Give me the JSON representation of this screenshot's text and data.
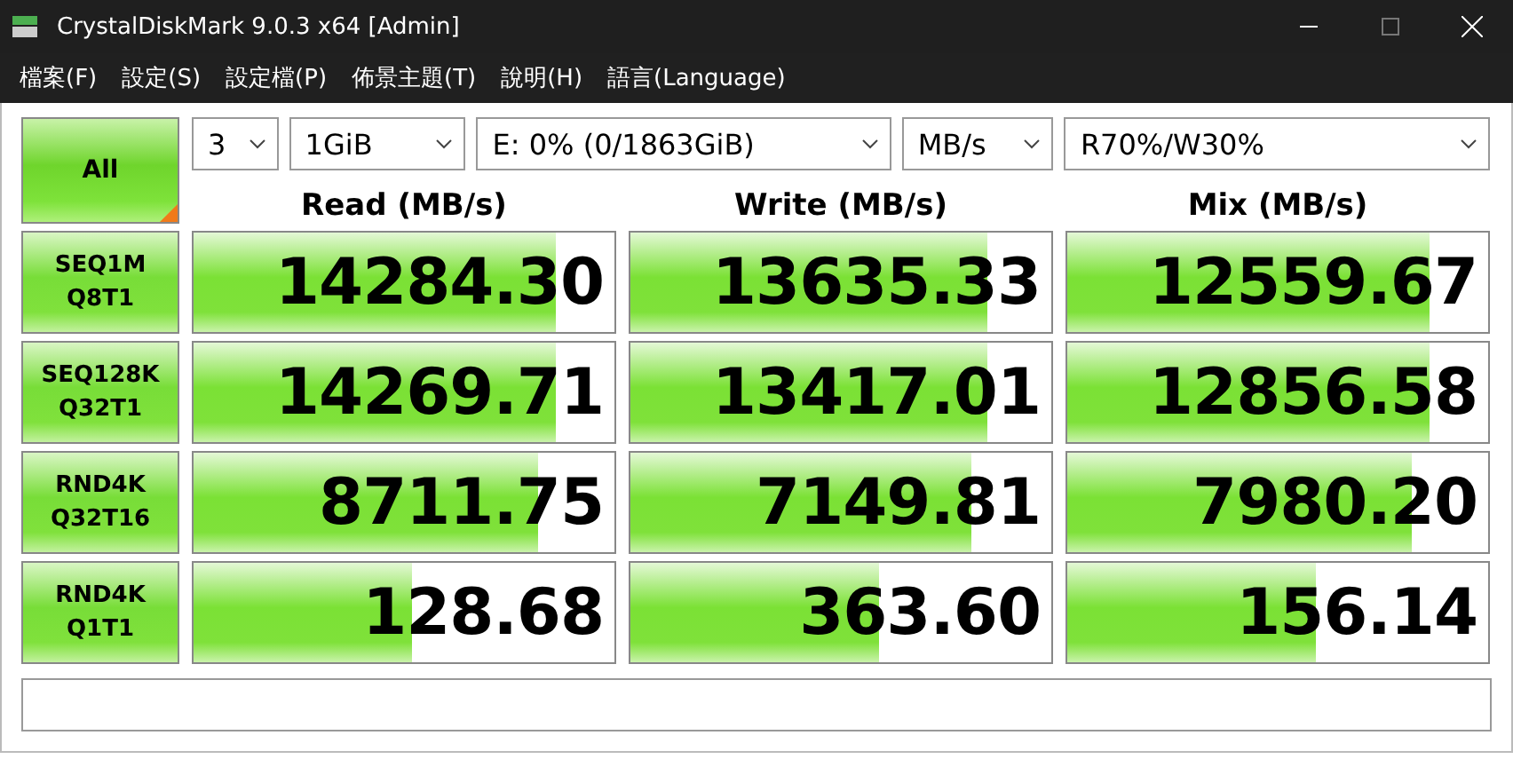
{
  "window": {
    "title": "CrystalDiskMark 9.0.3 x64 [Admin]"
  },
  "menu": [
    "檔案(F)",
    "設定(S)",
    "設定檔(P)",
    "佈景主題(T)",
    "說明(H)",
    "語言(Language)"
  ],
  "all_button": {
    "label": "All"
  },
  "selectors": [
    {
      "value": "3"
    },
    {
      "value": "1GiB"
    },
    {
      "value": "E: 0% (0/1863GiB)"
    },
    {
      "value": "MB/s"
    },
    {
      "value": "R70%/W30%"
    }
  ],
  "columns": [
    "Read (MB/s)",
    "Write (MB/s)",
    "Mix (MB/s)"
  ],
  "rows": [
    {
      "test": [
        "SEQ1M",
        "Q8T1"
      ],
      "results": [
        {
          "value": "14284.30",
          "level": 0.86
        },
        {
          "value": "13635.33",
          "level": 0.85
        },
        {
          "value": "12559.67",
          "level": 0.86
        }
      ]
    },
    {
      "test": [
        "SEQ128K",
        "Q32T1"
      ],
      "results": [
        {
          "value": "14269.71",
          "level": 0.86
        },
        {
          "value": "13417.01",
          "level": 0.85
        },
        {
          "value": "12856.58",
          "level": 0.86
        }
      ]
    },
    {
      "test": [
        "RND4K",
        "Q32T16"
      ],
      "results": [
        {
          "value": "8711.75",
          "level": 0.82
        },
        {
          "value": "7149.81",
          "level": 0.81
        },
        {
          "value": "7980.20",
          "level": 0.82
        }
      ]
    },
    {
      "test": [
        "RND4K",
        "Q1T1"
      ],
      "results": [
        {
          "value": "128.68",
          "level": 0.52
        },
        {
          "value": "363.60",
          "level": 0.59
        },
        {
          "value": "156.14",
          "level": 0.59
        }
      ]
    }
  ]
}
